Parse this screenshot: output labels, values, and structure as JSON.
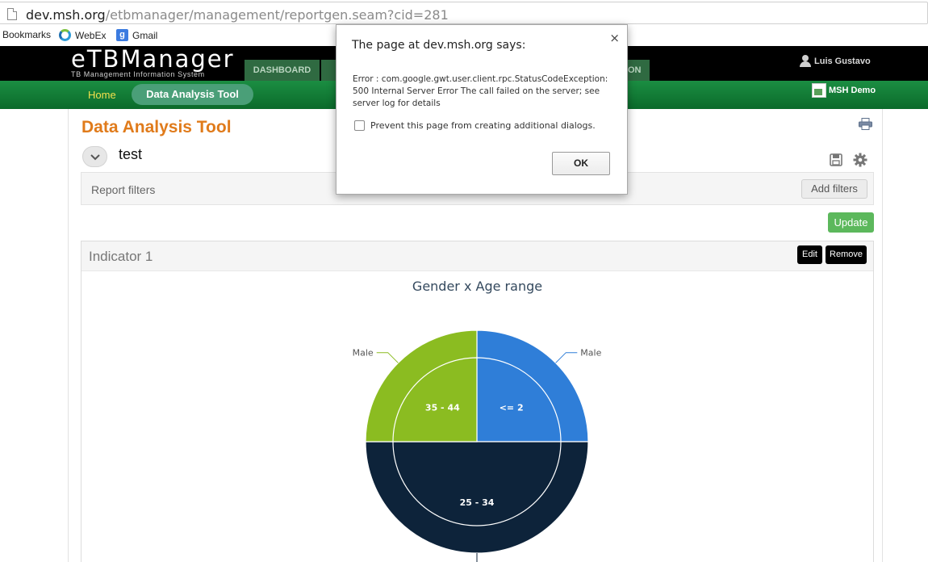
{
  "browser": {
    "url_host": "dev.msh.org",
    "url_path": "/etbmanager/management/reportgen.seam?cid=281",
    "bookmarks": [
      "Bookmarks",
      "WebEx",
      "Gmail"
    ]
  },
  "app": {
    "logo_main": "eTBManager",
    "logo_tb": "TB",
    "logo_sub": "TB Management Information System",
    "nav_tabs": [
      "DASHBOARD",
      "",
      "",
      "ON"
    ],
    "user_name": "Luis Gustavo",
    "home_label": "Home",
    "active_tab": "Data Analysis Tool",
    "workspace": "MSH Demo"
  },
  "page": {
    "title": "Data Analysis Tool",
    "report_name": "test",
    "filters_label": "Report filters",
    "add_filters_label": "Add filters",
    "update_label": "Update"
  },
  "indicator": {
    "title": "Indicator 1",
    "edit_label": "Edit",
    "remove_label": "Remove"
  },
  "chart_data": {
    "type": "pie",
    "title": "Gender x Age range",
    "inner_ring": [
      {
        "label": "<= 2",
        "value": 1,
        "color": "#2f7ed8"
      },
      {
        "label": "25 - 34",
        "value": 2,
        "color": "#0d233a"
      },
      {
        "label": "35 - 44",
        "value": 1,
        "color": "#8bbc21"
      }
    ],
    "outer_ring": [
      {
        "label": "Male",
        "value": 1,
        "color": "#2f7ed8"
      },
      {
        "label": "",
        "value": 2,
        "color": "#0d233a"
      },
      {
        "label": "Male",
        "value": 1,
        "color": "#8bbc21"
      }
    ]
  },
  "dialog": {
    "title": "The page at dev.msh.org says:",
    "message": "Error : com.google.gwt.user.client.rpc.StatusCodeException: 500 Internal Server Error The call failed on the server; see server log for details",
    "checkbox_label": "Prevent this page from creating additional dialogs.",
    "ok_label": "OK",
    "close_glyph": "×"
  }
}
